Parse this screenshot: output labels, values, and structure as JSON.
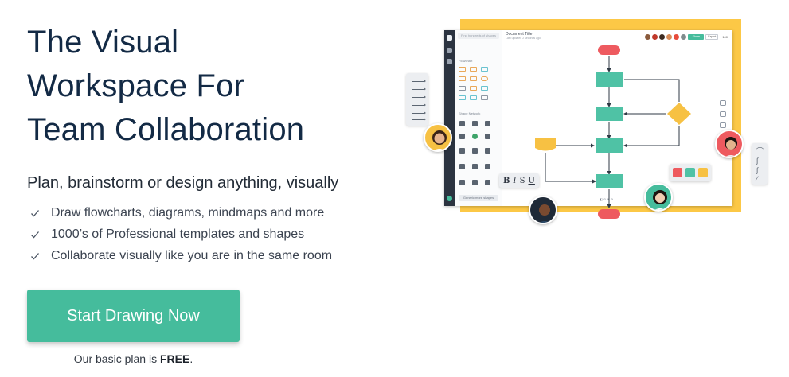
{
  "hero": {
    "title_line1": "The Visual",
    "title_line2": "Workspace For",
    "title_line3": "Team Collaboration",
    "subtitle": "Plan, brainstorm or design anything, visually",
    "features": [
      "Draw flowcharts, diagrams, mindmaps and more",
      "1000’s of Professional templates and shapes",
      "Collaborate visually like you are in the same room"
    ],
    "cta_label": "Start Drawing Now",
    "plan_note_prefix": "Our basic plan is ",
    "plan_note_highlight": "FREE",
    "plan_note_suffix": "."
  },
  "mockup": {
    "search_placeholder": "Find hundreds of shapes",
    "section_flowchart": "Flowchart",
    "section_shapes_network": "Shape Network",
    "more_shapes": "Generic more shapes",
    "document_title": "Document Title",
    "document_subtitle": "Last updated 2 seconds ago",
    "share_label": "Share",
    "export_label": "Export",
    "zoom_label": "100",
    "format_bold": "B",
    "format_italic": "I",
    "format_strike": "S",
    "format_underline": "U"
  },
  "colors": {
    "brand_green": "#45bc9c",
    "heading": "#132a45",
    "frame_yellow": "#fcc846",
    "shape_teal": "#4fc2a5",
    "shape_red": "#ee5a5f",
    "shape_yellow": "#f7c143",
    "connector": "#2f3a45"
  },
  "icons": {
    "check": "check-icon",
    "curve_connector": "curve-icon",
    "arrow_connector": "arrow-icon"
  }
}
